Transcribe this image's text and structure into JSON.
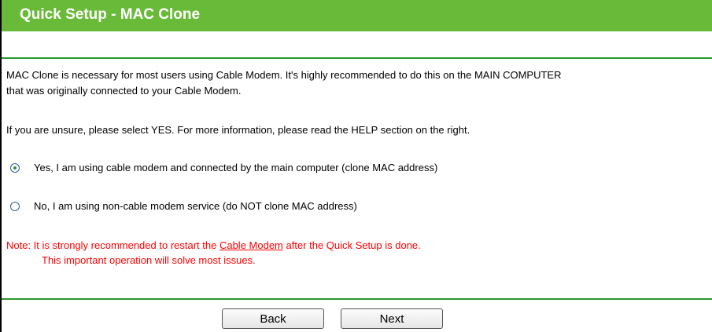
{
  "header": {
    "title": "Quick Setup - MAC Clone"
  },
  "content": {
    "paragraph1_line1": "MAC Clone is necessary for most users using Cable Modem. It's highly recommended to do this on the MAIN COMPUTER",
    "paragraph1_line2": "that was originally connected to your Cable Modem.",
    "paragraph2": "If you are unsure, please select YES. For more information, please read the HELP section on the right."
  },
  "options": {
    "yes_label": "Yes, I am using cable modem and connected by the main computer (clone MAC address)",
    "no_label": "No, I am using non-cable modem service (do NOT clone MAC address)",
    "selected": "yes"
  },
  "note": {
    "prefix": "Note: It is strongly recommended to restart the ",
    "link_text": "Cable Modem",
    "suffix": " after the Quick Setup is done.",
    "line2": "This important operation will solve most issues."
  },
  "buttons": {
    "back_label": "Back",
    "next_label": "Next"
  },
  "colors": {
    "header_bg": "#6aba3a",
    "rule": "#2a9a2a",
    "note_text": "#ff0000"
  }
}
